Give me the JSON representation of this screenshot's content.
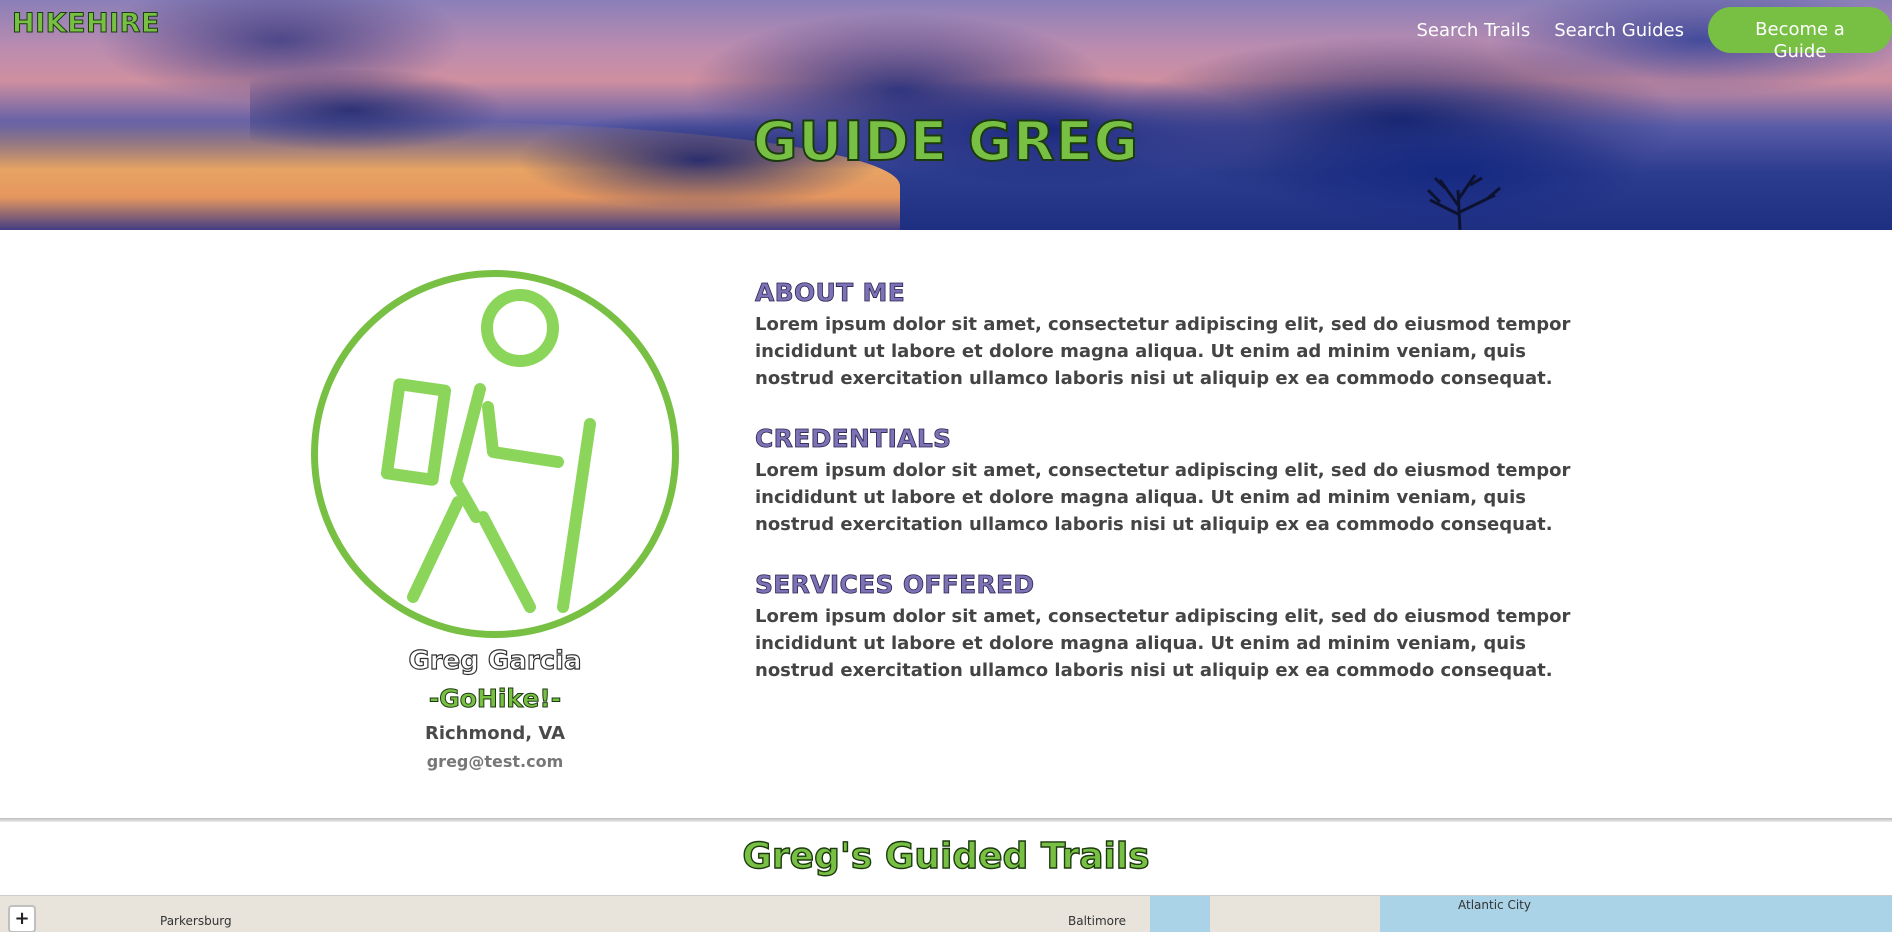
{
  "header": {
    "brand": "HIKEHIRE",
    "nav": {
      "search_trails": "Search Trails",
      "search_guides": "Search Guides",
      "become_guide": "Become a Guide"
    },
    "title": "GUIDE GREG"
  },
  "profile": {
    "avatar_icon": "hiker-icon",
    "name": "Greg Garcia",
    "tagline": "-GoHike!-",
    "location": "Richmond, VA",
    "email": "greg@test.com",
    "sections": [
      {
        "heading": "ABOUT ME",
        "body": "Lorem ipsum dolor sit amet, consectetur adipiscing elit, sed do eiusmod tempor incididunt ut labore et dolore magna aliqua. Ut enim ad minim veniam, quis nostrud exercitation ullamco laboris nisi ut aliquip ex ea commodo consequat."
      },
      {
        "heading": "CREDENTIALS",
        "body": "Lorem ipsum dolor sit amet, consectetur adipiscing elit, sed do eiusmod tempor incididunt ut labore et dolore magna aliqua. Ut enim ad minim veniam, quis nostrud exercitation ullamco laboris nisi ut aliquip ex ea commodo consequat."
      },
      {
        "heading": "SERVICES OFFERED",
        "body": "Lorem ipsum dolor sit amet, consectetur adipiscing elit, sed do eiusmod tempor incididunt ut labore et dolore magna aliqua. Ut enim ad minim veniam, quis nostrud exercitation ullamco laboris nisi ut aliquip ex ea commodo consequat."
      }
    ]
  },
  "trails": {
    "title": "Greg's Guided Trails",
    "map": {
      "zoom_in": "+",
      "labels": [
        "Parkersburg",
        "Baltimore",
        "Atlantic City"
      ]
    }
  },
  "colors": {
    "accent_green": "#78c043",
    "heading_purple": "#7e72b6"
  }
}
